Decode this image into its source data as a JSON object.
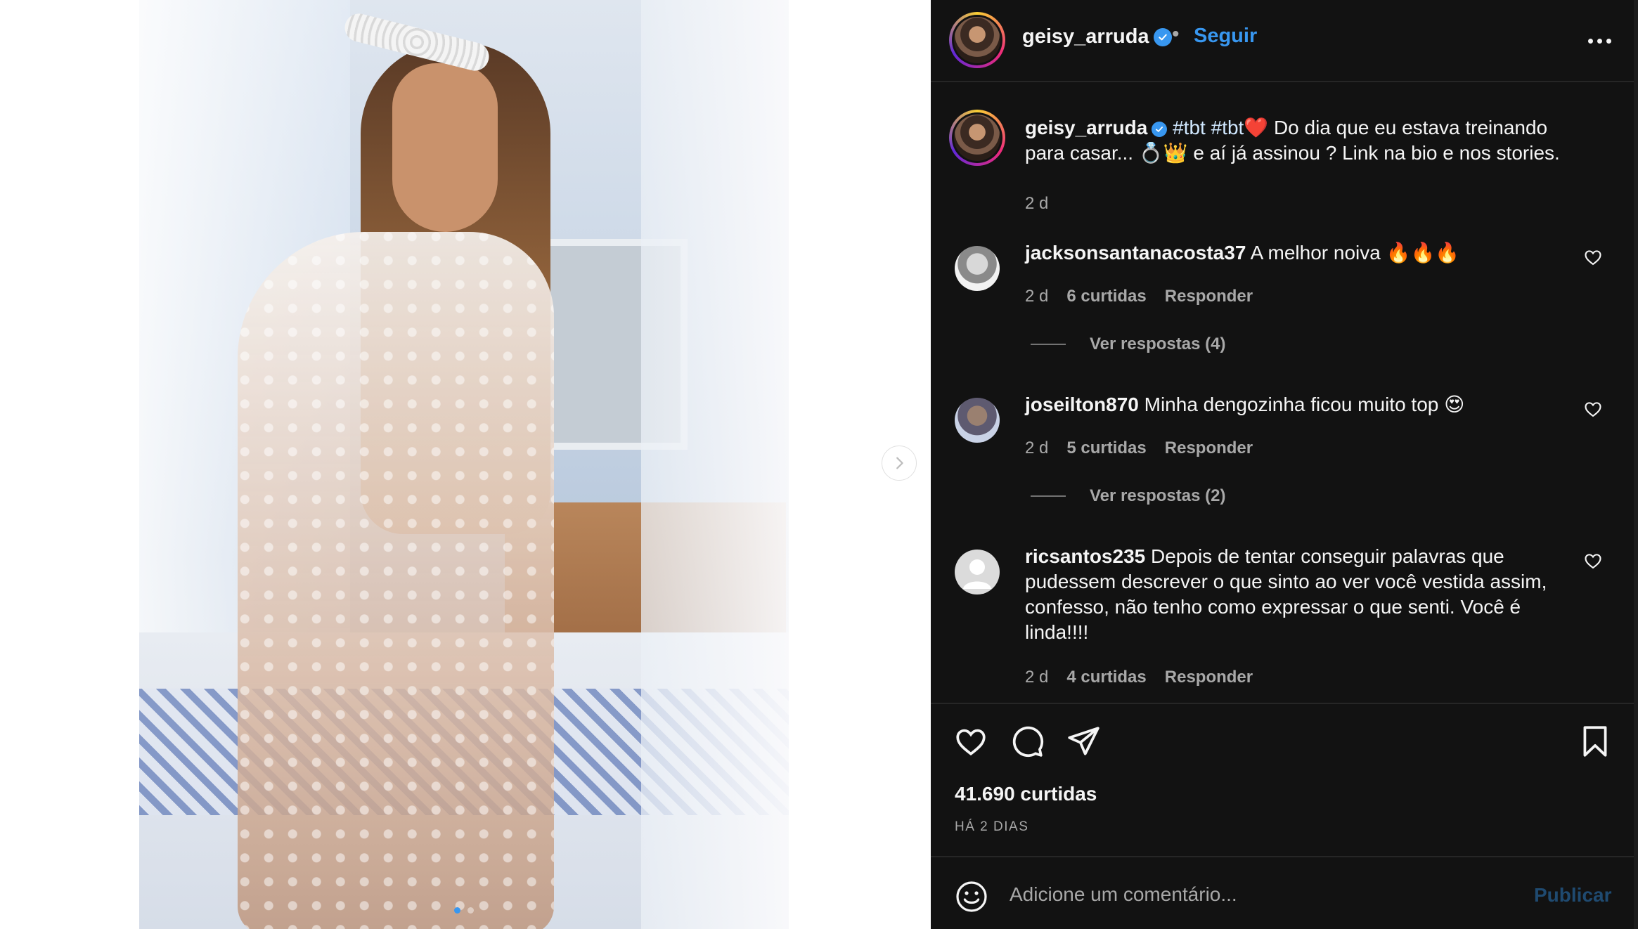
{
  "post": {
    "author": "geisy_arruda",
    "follow_label": "Seguir",
    "separator": "•",
    "caption_hashtags": "#tbt #tbt❤️",
    "caption_text": "Do dia que eu estava treinando para casar... 💍👑 e aí já assinou ? Link na bio e nos stories.",
    "caption_time": "2 d",
    "likes": "41.690 curtidas",
    "posted_ago": "HÁ 2 DIAS",
    "carousel": {
      "slides": 2,
      "active_index": 0
    }
  },
  "comments": [
    {
      "user": "jacksonsantanacosta37",
      "text": "A melhor noiva 🔥🔥🔥",
      "time": "2 d",
      "likes": "6 curtidas",
      "reply_label": "Responder",
      "view_replies": "Ver respostas (4)"
    },
    {
      "user": "joseilton870",
      "text": "Minha dengozinha ficou muito top 😍",
      "time": "2 d",
      "likes": "5 curtidas",
      "reply_label": "Responder",
      "view_replies": "Ver respostas (2)"
    },
    {
      "user": "ricsantos235",
      "text": "Depois de tentar conseguir palavras que pudessem descrever o que sinto ao ver você vestida assim, confesso, não tenho como expressar o que senti. Você é linda!!!!",
      "time": "2 d",
      "likes": "4 curtidas",
      "reply_label": "Responder"
    }
  ],
  "composer": {
    "placeholder": "Adicione um comentário...",
    "publish_label": "Publicar"
  },
  "icons": {
    "like": "heart-icon",
    "comment": "comment-icon",
    "share": "share-icon",
    "save": "bookmark-icon",
    "emoji": "emoji-icon",
    "more": "more-icon",
    "next": "chevron-right-icon",
    "verified": "verified-badge-icon"
  },
  "colors": {
    "panel_bg": "#121212",
    "accent": "#3897f0",
    "muted": "#a8a8a8",
    "text": "#f5f5f5"
  }
}
